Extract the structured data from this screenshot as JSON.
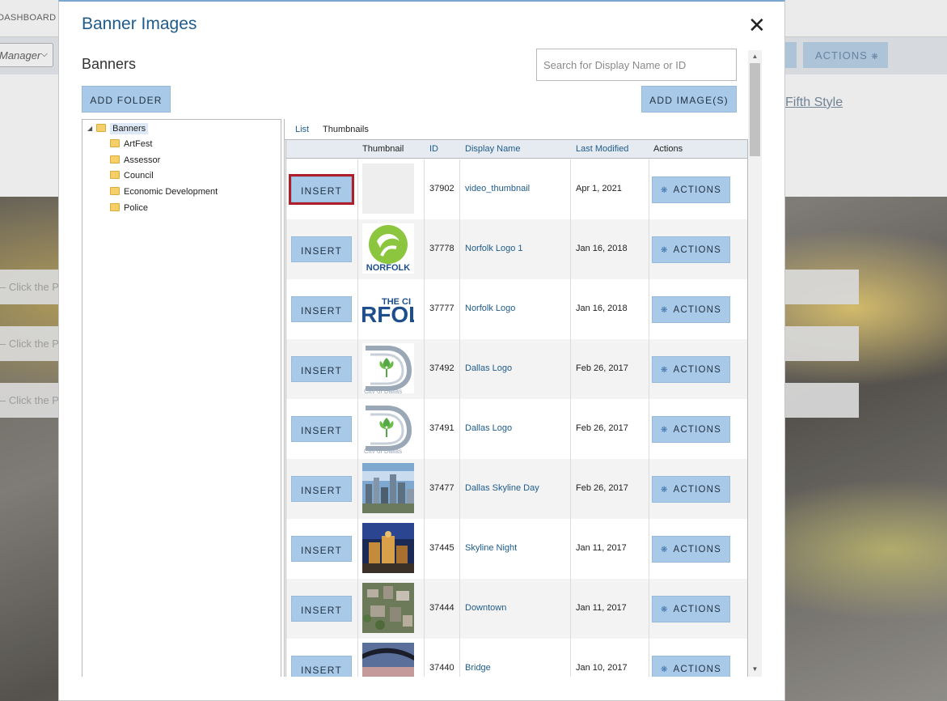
{
  "background": {
    "dashboard_label": "DASHBOARD",
    "manager_select_value": "Manager",
    "actions_label": "ACTIONS",
    "link_text": "Fifth Style",
    "bar_text": "– Click the P"
  },
  "modal": {
    "title": "Banner Images",
    "close_glyph": "✕",
    "subtitle": "Banners",
    "search_placeholder": "Search for Display Name or ID",
    "add_folder_label": "ADD FOLDER",
    "add_images_label": "ADD IMAGE(S)"
  },
  "tree": {
    "root": "Banners",
    "children": [
      "ArtFest",
      "Assessor",
      "Council",
      "Economic Development",
      "Police"
    ]
  },
  "tabs": {
    "list": "List",
    "thumbnails": "Thumbnails"
  },
  "table": {
    "columns": {
      "thumbnail": "Thumbnail",
      "id": "ID",
      "display_name": "Display Name",
      "last_modified": "Last Modified",
      "actions": "Actions"
    },
    "insert_label": "INSERT",
    "actions_label": "ACTIONS",
    "rows": [
      {
        "id": "37902",
        "name": "video_thumbnail",
        "modified": "Apr 1, 2021",
        "thumb": "blank",
        "selected": true
      },
      {
        "id": "37778",
        "name": "Norfolk Logo 1",
        "modified": "Jan 16, 2018",
        "thumb": "norfolk-logo-green"
      },
      {
        "id": "37777",
        "name": "Norfolk Logo",
        "modified": "Jan 16, 2018",
        "thumb": "norfolk-wordmark"
      },
      {
        "id": "37492",
        "name": "Dallas Logo",
        "modified": "Feb 26, 2017",
        "thumb": "dallas-logo"
      },
      {
        "id": "37491",
        "name": "Dallas Logo",
        "modified": "Feb 26, 2017",
        "thumb": "dallas-logo"
      },
      {
        "id": "37477",
        "name": "Dallas Skyline Day",
        "modified": "Feb 26, 2017",
        "thumb": "skyline-day"
      },
      {
        "id": "37445",
        "name": "Skyline Night",
        "modified": "Jan 11, 2017",
        "thumb": "skyline-night"
      },
      {
        "id": "37444",
        "name": "Downtown",
        "modified": "Jan 11, 2017",
        "thumb": "aerial-downtown"
      },
      {
        "id": "37440",
        "name": "Bridge",
        "modified": "Jan 10, 2017",
        "thumb": "bridge-sunset"
      }
    ]
  },
  "thumb_text": {
    "norfolk_small": "NORFOLK",
    "norfolk_the": "THE CI",
    "norfolk_big": "RFOL",
    "dallas_city": "City of Dallas"
  },
  "colors": {
    "brand_blue": "#1e5b8c",
    "button_bg": "#a9c9e8",
    "selected_outline": "#b01e2a",
    "norfolk_green": "#8cc63f"
  }
}
